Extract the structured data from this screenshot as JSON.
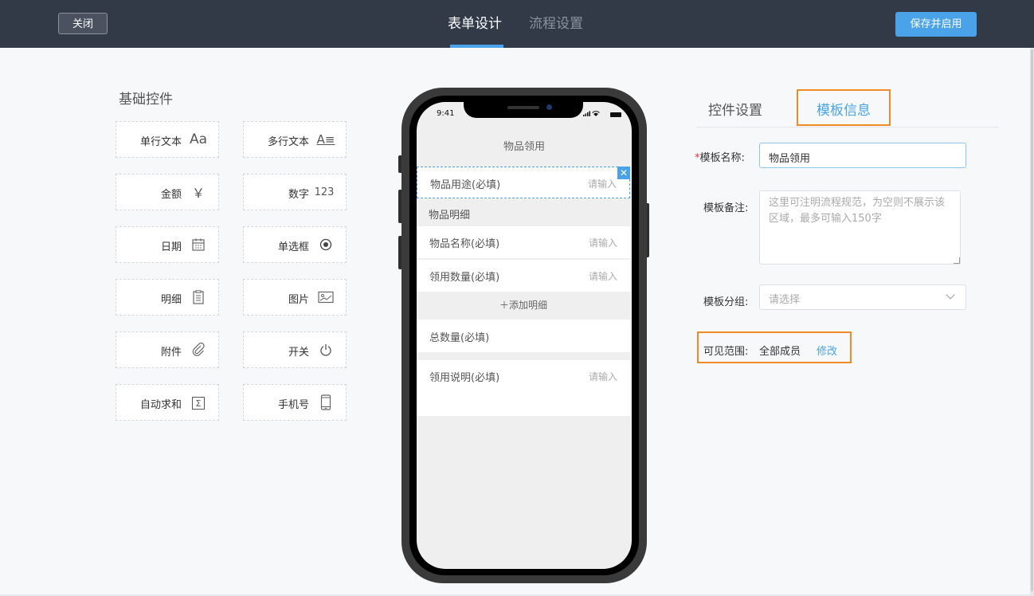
{
  "header": {
    "close_label": "关闭",
    "tabs": [
      {
        "label": "表单设计"
      },
      {
        "label": "流程设置"
      }
    ],
    "active_tab": "表单设计",
    "save_label": "保存并启用",
    "accent_color": "#4aa3e8",
    "bar_color": "#323a48"
  },
  "left_panel": {
    "title": "基础控件",
    "controls": [
      {
        "label": "单行文本",
        "icon": "Aa",
        "icon_name": "text-icon"
      },
      {
        "label": "多行文本",
        "icon": "A≡",
        "icon_name": "multiline-text-icon"
      },
      {
        "label": "金额",
        "icon": "￥",
        "icon_name": "currency-icon"
      },
      {
        "label": "数字",
        "icon": "123",
        "icon_name": "number-icon"
      },
      {
        "label": "日期",
        "icon": "",
        "icon_name": "calendar-icon"
      },
      {
        "label": "单选框",
        "icon": "",
        "icon_name": "radio-icon"
      },
      {
        "label": "明细",
        "icon": "",
        "icon_name": "clipboard-icon"
      },
      {
        "label": "图片",
        "icon": "",
        "icon_name": "image-icon"
      },
      {
        "label": "附件",
        "icon": "",
        "icon_name": "paperclip-icon"
      },
      {
        "label": "开关",
        "icon": "",
        "icon_name": "power-icon"
      },
      {
        "label": "自动求和",
        "icon": "Σ",
        "icon_name": "sum-icon"
      },
      {
        "label": "手机号",
        "icon": "",
        "icon_name": "mobile-icon"
      }
    ]
  },
  "phone": {
    "time": "9:41",
    "title": "物品领用",
    "fields": [
      {
        "label": "物品用途(必填)",
        "placeholder": "请输入"
      },
      {
        "label": "物品名称(必填)",
        "placeholder": "请输入"
      },
      {
        "label": "领用数量(必填)",
        "placeholder": "请输入"
      },
      {
        "label": "总数量(必填)",
        "placeholder": ""
      },
      {
        "label": "领用说明(必填)",
        "placeholder": "请输入"
      }
    ],
    "detail_section": "物品明细",
    "add_detail": "＋添加明细",
    "delete_mark": "✕"
  },
  "right_panel": {
    "tabs": [
      {
        "label": "控件设置"
      },
      {
        "label": "模板信息"
      }
    ],
    "active_tab": "模板信息",
    "name_required_mark": "*",
    "name_label": "模板名称:",
    "name_value": "物品领用",
    "remark_label": "模板备注:",
    "remark_placeholder": "这里可注明流程规范，为空则不展示该区域，最多可输入150字",
    "group_label": "模板分组:",
    "group_placeholder": "请选择",
    "visibility_label": "可见范围:",
    "visibility_value": "全部成员",
    "visibility_edit": "修改",
    "highlight_color": "#f08a24"
  }
}
